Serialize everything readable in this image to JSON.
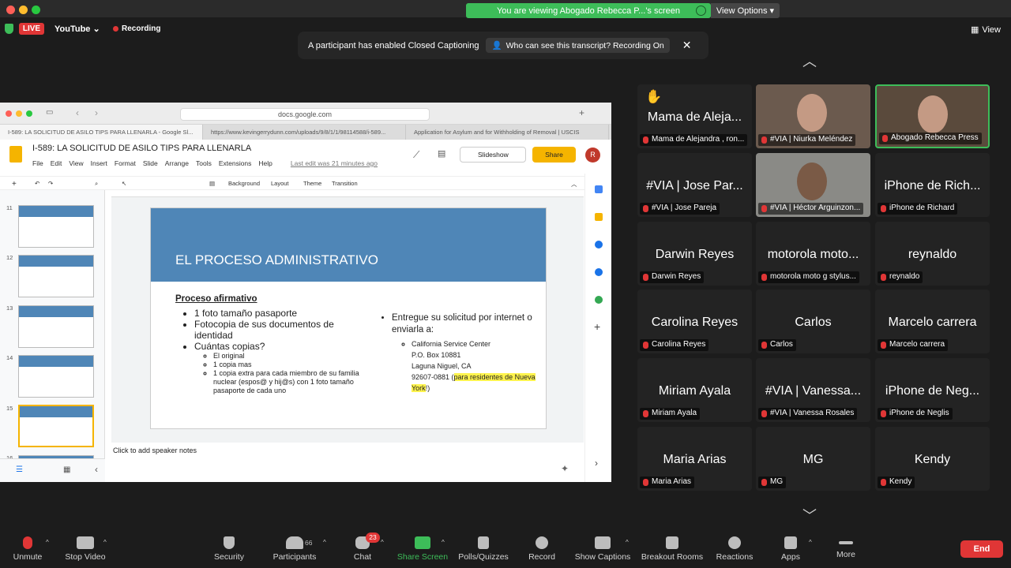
{
  "banner": {
    "text": "You are viewing Abogado Rebecca P...'s screen",
    "view_options": "View Options"
  },
  "topbar": {
    "live": "LIVE",
    "platform": "YouTube",
    "recording": "Recording",
    "view": "View"
  },
  "toast": {
    "message": "A participant has enabled Closed Captioning",
    "link": "Who can see this transcript? Recording On"
  },
  "browser": {
    "url": "docs.google.com",
    "tabs": [
      "I-589: LA SOLICITUD DE ASILO TIPS PARA LLENARLA - Google Sl...",
      "https://www.kevingerrydunn.com/uploads/9/8/1/1/98114588/i-589...",
      "Application for Asylum and for Withholding of Removal | USCIS"
    ]
  },
  "doc": {
    "title": "I-589: LA SOLICITUD DE ASILO TIPS PARA LLENARLA",
    "menus": [
      "File",
      "Edit",
      "View",
      "Insert",
      "Format",
      "Slide",
      "Arrange",
      "Tools",
      "Extensions",
      "Help"
    ],
    "last_edit": "Last edit was 21 minutes ago",
    "slideshow": "Slideshow",
    "share": "Share",
    "avatar": "R",
    "toolbar": {
      "background": "Background",
      "layout": "Layout",
      "theme": "Theme",
      "transition": "Transition"
    },
    "thumb_numbers": [
      "11",
      "12",
      "13",
      "14",
      "15",
      "16"
    ],
    "notes": "Click to add speaker notes"
  },
  "slide": {
    "title": "EL PROCESO ADMINISTRATIVO",
    "heading": "Proceso afirmativo",
    "items": [
      "1 foto tamaño pasaporte",
      "Fotocopia de sus documentos de identidad",
      "Cuántas copias?"
    ],
    "subitems": [
      "El original",
      "1 copia mas",
      "1 copia extra para cada miembro de su familia nuclear (espos@ y hij@s) con 1 foto tamaño pasaporte de cada uno"
    ],
    "right_item": "Entregue su solicitud por internet o enviarla a:",
    "address": [
      "California Service Center",
      "P.O.  Box 10881",
      "Laguna Niguel, CA",
      "92607-0881 ("
    ],
    "highlight": "para residentes de Nueva York",
    "address_end": "!)"
  },
  "participants": [
    {
      "big": "Mama de Aleja...",
      "label": "Mama de Alejandra , ron..."
    },
    {
      "big": "",
      "label": "#VIA | Niurka Meléndez"
    },
    {
      "big": "",
      "label": "Abogado Rebecca Press"
    },
    {
      "big": "#VIA | Jose Par...",
      "label": "#VIA | Jose Pareja"
    },
    {
      "big": "",
      "label": "#VIA | Héctor Arguinzon..."
    },
    {
      "big": "iPhone de Rich...",
      "label": "iPhone de Richard"
    },
    {
      "big": "Darwin Reyes",
      "label": "Darwin Reyes"
    },
    {
      "big": "motorola moto...",
      "label": "motorola moto g stylus..."
    },
    {
      "big": "reynaldo",
      "label": "reynaldo"
    },
    {
      "big": "Carolina Reyes",
      "label": "Carolina Reyes"
    },
    {
      "big": "Carlos",
      "label": "Carlos"
    },
    {
      "big": "Marcelo carrera",
      "label": "Marcelo carrera"
    },
    {
      "big": "Miriam Ayala",
      "label": "Miriam Ayala"
    },
    {
      "big": "#VIA | Vanessa...",
      "label": "#VIA | Vanessa Rosales"
    },
    {
      "big": "iPhone de Neg...",
      "label": "iPhone de Neglis"
    },
    {
      "big": "Maria Arias",
      "label": "Maria Arias"
    },
    {
      "big": "MG",
      "label": "MG"
    },
    {
      "big": "Kendy",
      "label": "Kendy"
    }
  ],
  "toolbar": {
    "unmute": "Unmute",
    "stop_video": "Stop Video",
    "security": "Security",
    "participants": "Participants",
    "participants_count": "66",
    "chat": "Chat",
    "chat_badge": "23",
    "share_screen": "Share Screen",
    "polls": "Polls/Quizzes",
    "record": "Record",
    "captions": "Show Captions",
    "breakout": "Breakout Rooms",
    "reactions": "Reactions",
    "apps": "Apps",
    "more": "More",
    "end": "End"
  }
}
